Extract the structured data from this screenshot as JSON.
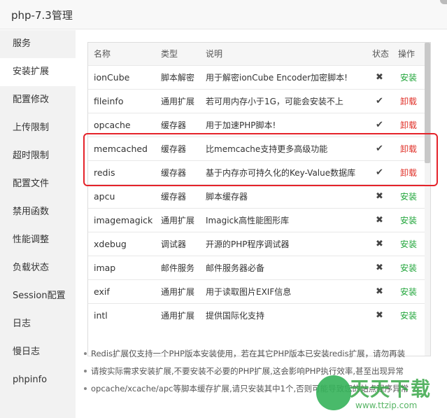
{
  "window": {
    "title": "php-7.3管理"
  },
  "sidebar": {
    "items": [
      {
        "label": "服务",
        "active": false
      },
      {
        "label": "安装扩展",
        "active": true
      },
      {
        "label": "配置修改",
        "active": false
      },
      {
        "label": "上传限制",
        "active": false
      },
      {
        "label": "超时限制",
        "active": false
      },
      {
        "label": "配置文件",
        "active": false
      },
      {
        "label": "禁用函数",
        "active": false
      },
      {
        "label": "性能调整",
        "active": false
      },
      {
        "label": "负载状态",
        "active": false
      },
      {
        "label": "Session配置",
        "active": false
      },
      {
        "label": "日志",
        "active": false
      },
      {
        "label": "慢日志",
        "active": false
      },
      {
        "label": "phpinfo",
        "active": false
      }
    ]
  },
  "table": {
    "headers": {
      "name": "名称",
      "type": "类型",
      "desc": "说明",
      "status": "状态",
      "op": "操作"
    },
    "rows": [
      {
        "name": "ionCube",
        "type": "脚本解密",
        "desc": "用于解密ionCube Encoder加密脚本!",
        "status": "✖",
        "op": "安装",
        "op_kind": "install"
      },
      {
        "name": "fileinfo",
        "type": "通用扩展",
        "desc": "若可用内存小于1G，可能会安装不上",
        "status": "✔",
        "op": "卸载",
        "op_kind": "uninstall"
      },
      {
        "name": "opcache",
        "type": "缓存器",
        "desc": "用于加速PHP脚本!",
        "status": "✔",
        "op": "卸载",
        "op_kind": "uninstall"
      },
      {
        "name": "memcached",
        "type": "缓存器",
        "desc": "比memcache支持更多高级功能",
        "status": "✔",
        "op": "卸载",
        "op_kind": "uninstall"
      },
      {
        "name": "redis",
        "type": "缓存器",
        "desc": "基于内存亦可持久化的Key-Value数据库",
        "status": "✔",
        "op": "卸载",
        "op_kind": "uninstall"
      },
      {
        "name": "apcu",
        "type": "缓存器",
        "desc": "脚本缓存器",
        "status": "✖",
        "op": "安装",
        "op_kind": "install"
      },
      {
        "name": "imagemagick",
        "type": "通用扩展",
        "desc": "Imagick高性能图形库",
        "status": "✖",
        "op": "安装",
        "op_kind": "install"
      },
      {
        "name": "xdebug",
        "type": "调试器",
        "desc": "开源的PHP程序调试器",
        "status": "✖",
        "op": "安装",
        "op_kind": "install"
      },
      {
        "name": "imap",
        "type": "邮件服务",
        "desc": "邮件服务器必备",
        "status": "✖",
        "op": "安装",
        "op_kind": "install"
      },
      {
        "name": "exif",
        "type": "通用扩展",
        "desc": "用于读取图片EXIF信息",
        "status": "✖",
        "op": "安装",
        "op_kind": "install"
      },
      {
        "name": "intl",
        "type": "通用扩展",
        "desc": "提供国际化支持",
        "status": "✖",
        "op": "安装",
        "op_kind": "install"
      }
    ]
  },
  "notes": [
    "Redis扩展仅支持一个PHP版本安装使用，若在其它PHP版本已安装redis扩展，请勿再装",
    "请按实际需求安装扩展,不要安装不必要的PHP扩展,这会影响PHP执行效率,甚至出现异常",
    "opcache/xcache/apc等脚本缓存扩展,请只安装其中1个,否则可能导致您的站点程序异常"
  ],
  "watermark": {
    "text": "天天下载",
    "url": "www.ttzip.com"
  },
  "colors": {
    "install": "#20a53a",
    "uninstall": "#e0322a",
    "highlight": "#e5232a"
  }
}
